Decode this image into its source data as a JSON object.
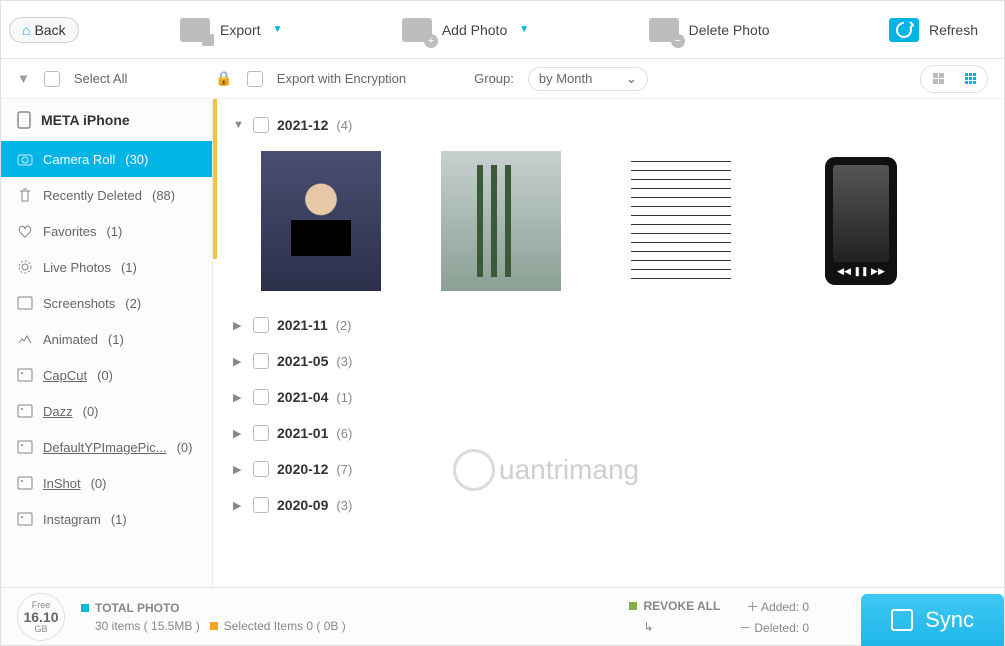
{
  "toolbar": {
    "back": "Back",
    "export": "Export",
    "add_photo": "Add Photo",
    "delete_photo": "Delete Photo",
    "refresh": "Refresh"
  },
  "filterbar": {
    "select_all": "Select All",
    "export_encryption": "Export with Encryption",
    "group_label": "Group:",
    "group_value": "by Month"
  },
  "device_name": "META iPhone",
  "sidebar": [
    {
      "label": "Camera Roll",
      "count": "(30)",
      "icon": "camera",
      "active": true
    },
    {
      "label": "Recently Deleted",
      "count": "(88)",
      "icon": "trash"
    },
    {
      "label": "Favorites",
      "count": "(1)",
      "icon": "heart"
    },
    {
      "label": "Live Photos",
      "count": "(1)",
      "icon": "live"
    },
    {
      "label": "Screenshots",
      "count": "(2)",
      "icon": "screenshot"
    },
    {
      "label": "Animated",
      "count": "(1)",
      "icon": "animated"
    },
    {
      "label": "CapCut",
      "count": "(0)",
      "icon": "album",
      "underlined": true
    },
    {
      "label": "Dazz",
      "count": "(0)",
      "icon": "album",
      "underlined": true
    },
    {
      "label": "DefaultYPImagePic...",
      "count": "(0)",
      "icon": "album",
      "underlined": true
    },
    {
      "label": "InShot",
      "count": "(0)",
      "icon": "album",
      "underlined": true
    },
    {
      "label": "Instagram",
      "count": "(1)",
      "icon": "album"
    }
  ],
  "groups": [
    {
      "title": "2021-12",
      "count": "(4)",
      "expanded": true
    },
    {
      "title": "2021-11",
      "count": "(2)"
    },
    {
      "title": "2021-05",
      "count": "(3)"
    },
    {
      "title": "2021-04",
      "count": "(1)"
    },
    {
      "title": "2021-01",
      "count": "(6)"
    },
    {
      "title": "2020-12",
      "count": "(7)"
    },
    {
      "title": "2020-09",
      "count": "(3)"
    }
  ],
  "watermark": "uantrimang",
  "footer": {
    "storage_free_label": "Free",
    "storage_value": "16.10",
    "storage_unit": "GB",
    "total_photo_label": "TOTAL PHOTO",
    "total_photo_detail": "30 items ( 15.5MB )",
    "selected_label": "Selected Items 0 ( 0B )",
    "revoke_label": "REVOKE ALL",
    "revoke_icon": "↳",
    "added_label": "Added: 0",
    "deleted_label": "Deleted: 0",
    "sync": "Sync"
  }
}
